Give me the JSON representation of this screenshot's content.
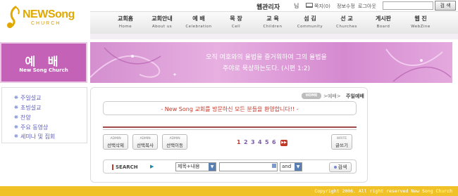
{
  "logo": {
    "name": "NEWSong",
    "sub": "CHURCH"
  },
  "topbar": {
    "admin_name": "웹관리자",
    "admin_suffix": "님",
    "messages_link": "쪽지(0)",
    "profile_link": "정보수정",
    "logout_link": "로그아웃",
    "search_button": "검 색"
  },
  "nav": [
    {
      "ko": "교회홈",
      "en": "Home"
    },
    {
      "ko": "교회안내",
      "en": "About us"
    },
    {
      "ko": "예 배",
      "en": "Celebration"
    },
    {
      "ko": "목 장",
      "en": "Cell"
    },
    {
      "ko": "교 육",
      "en": "Children"
    },
    {
      "ko": "섬 김",
      "en": "Community"
    },
    {
      "ko": "선 교",
      "en": "Churches"
    },
    {
      "ko": "게시판",
      "en": "Board"
    },
    {
      "ko": "웹 진",
      "en": "WebZine"
    }
  ],
  "side": {
    "title": "예 배",
    "subtitle": "New Song Church",
    "menu": [
      "주일설교",
      "초빙설교",
      "찬양",
      "주요 동영상",
      "세미나 및 집회"
    ]
  },
  "banner": {
    "line1": "오직 여호와의 율법을 즐거워하여 그의 율법을",
    "line2": "주야로 묵상하는도다. (시편 1:2)"
  },
  "breadcrumb": {
    "home": "HOME",
    "rest": ">예배>",
    "current": "주일예배"
  },
  "welcome": "- New Song 교회를 방문하신 모든 분들을 환영합니다!! -",
  "admin_buttons": [
    {
      "top": "ADMIN",
      "label": "선택삭제"
    },
    {
      "top": "ADMIN",
      "label": "선택복사"
    },
    {
      "top": "ADMIN",
      "label": "선택이동"
    }
  ],
  "pagination": {
    "pages": [
      "1",
      "2",
      "3",
      "4",
      "5",
      "6"
    ],
    "current": "1",
    "next": "▶▶"
  },
  "write_button": {
    "top": "WRITE",
    "label": "글쓰기"
  },
  "search": {
    "label": "SEARCH",
    "field": "제목+내용",
    "operator": "and",
    "submit": "검색"
  },
  "footer": "Copyright 2006. All right reserved New Song Church",
  "colors": {
    "brand": "#f0c228",
    "accent": "#c462b8",
    "alert": "#c0392b"
  }
}
